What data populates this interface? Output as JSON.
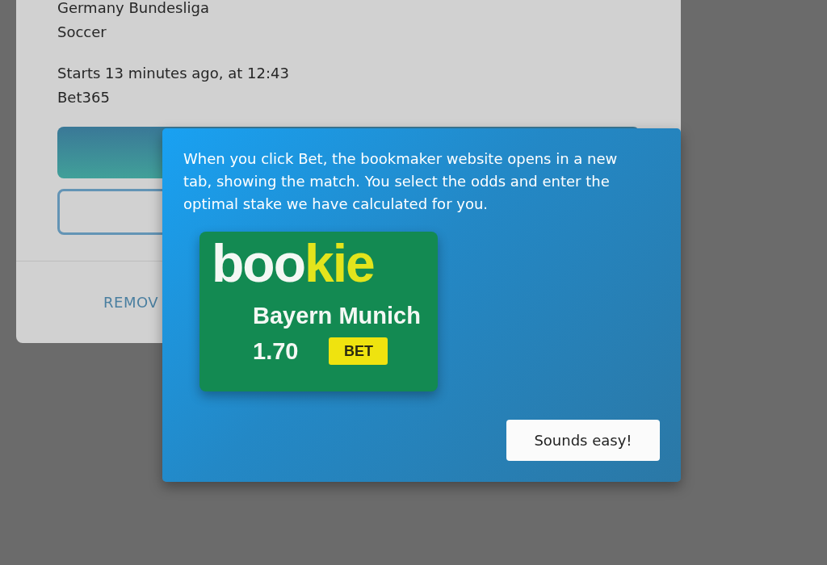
{
  "event_card": {
    "league": "Germany Bundesliga",
    "sport": "Soccer",
    "start_time": "Starts 13 minutes ago, at 12:43",
    "bookmaker": "Bet365",
    "remove_link": "REMOV"
  },
  "tour_popup": {
    "message": "When you click Bet, the bookmaker website opens in a new tab, showing the match. You select the odds and enter the optimal stake we have calculated for you.",
    "example": {
      "logo_prefix": "boo",
      "logo_suffix": "kie",
      "team": "Bayern Munich",
      "odds": "1.70",
      "bet_button": "BET"
    },
    "confirm_button": "Sounds easy!"
  }
}
